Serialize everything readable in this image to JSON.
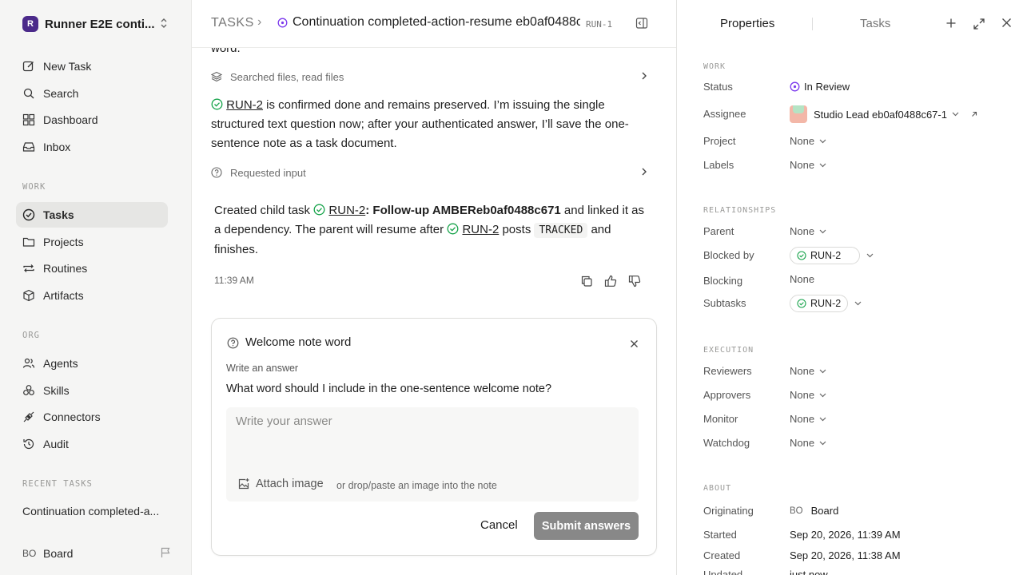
{
  "sidebar": {
    "workspace": {
      "logo": "R",
      "name": "Runner E2E conti..."
    },
    "top_nav": [
      {
        "label": "New Task",
        "icon": "edit-icon"
      },
      {
        "label": "Search",
        "icon": "search-icon"
      },
      {
        "label": "Dashboard",
        "icon": "dashboard-icon"
      },
      {
        "label": "Inbox",
        "icon": "inbox-icon"
      }
    ],
    "work_label": "WORK",
    "work_nav": [
      {
        "label": "Tasks",
        "icon": "check-circle-icon",
        "active": true
      },
      {
        "label": "Projects",
        "icon": "folder-icon"
      },
      {
        "label": "Routines",
        "icon": "repeat-icon"
      },
      {
        "label": "Artifacts",
        "icon": "box-icon"
      }
    ],
    "org_label": "ORG",
    "org_nav": [
      {
        "label": "Agents",
        "icon": "users-icon"
      },
      {
        "label": "Skills",
        "icon": "skills-icon"
      },
      {
        "label": "Connectors",
        "icon": "plug-icon"
      },
      {
        "label": "Audit",
        "icon": "history-icon"
      }
    ],
    "recent_label": "RECENT TASKS",
    "recent_item": "Continuation completed-a...",
    "user": {
      "initials": "BO",
      "name": "Board"
    }
  },
  "header": {
    "crumb_root": "TASKS",
    "crumb_sep": "›",
    "title": "Continuation completed-action-resume eb0af0488c...",
    "task_id": "RUN-1"
  },
  "thread": {
    "cut_word": "word.",
    "step1": "Searched files, read files",
    "para1": {
      "link": "RUN-2",
      "text": " is confirmed done and remains preserved. I’m issuing the single structured text question now; after your authenticated answer, I’ll save the one-sentence note as a task document."
    },
    "step2": "Requested input",
    "para2": {
      "t1": "Created child task ",
      "link1": "RUN-2",
      "bold": ": Follow-up AMBEReb0af0488c671",
      "t2": " and linked it as a dependency. The parent will resume after ",
      "link2": "RUN-2",
      "t3": " posts ",
      "code": "TRACKED",
      "t4": " and finishes."
    },
    "time": "11:39 AM"
  },
  "question_card": {
    "title": "Welcome note word",
    "label": "Write an answer",
    "question": "What word should I include in the one-sentence welcome note?",
    "placeholder": "Write your answer",
    "attach_label": "Attach image",
    "attach_hint": "or drop/paste an image into the note",
    "cancel_label": "Cancel",
    "submit_label": "Submit answers"
  },
  "panel": {
    "tab_properties": "Properties",
    "tab_tasks": "Tasks",
    "work_label": "WORK",
    "status_key": "Status",
    "status_val": "In Review",
    "assignee_key": "Assignee",
    "assignee_val": "Studio Lead eb0af0488c67-1",
    "project_key": "Project",
    "project_val": "None",
    "labels_key": "Labels",
    "labels_val": "None",
    "rel_label": "RELATIONSHIPS",
    "parent_key": "Parent",
    "parent_val": "None",
    "blockedby_key": "Blocked by",
    "blockedby_val": "RUN-2",
    "blocking_key": "Blocking",
    "blocking_val": "None",
    "subtasks_key": "Subtasks",
    "subtasks_val": "RUN-2",
    "exec_label": "EXECUTION",
    "reviewers_key": "Reviewers",
    "reviewers_val": "None",
    "approvers_key": "Approvers",
    "approvers_val": "None",
    "monitor_key": "Monitor",
    "monitor_val": "None",
    "watchdog_key": "Watchdog",
    "watchdog_val": "None",
    "about_label": "ABOUT",
    "orig_key": "Originating",
    "orig_initials": "BO",
    "orig_val": "Board",
    "started_key": "Started",
    "started_val": "Sep 20, 2026, 11:39 AM",
    "created_key": "Created",
    "created_val": "Sep 20, 2026, 11:38 AM",
    "updated_key": "Updated",
    "updated_val": "just now"
  },
  "colors": {
    "accent": "#7c3aed",
    "success": "#16a34a",
    "submit_disabled": "#888888"
  }
}
